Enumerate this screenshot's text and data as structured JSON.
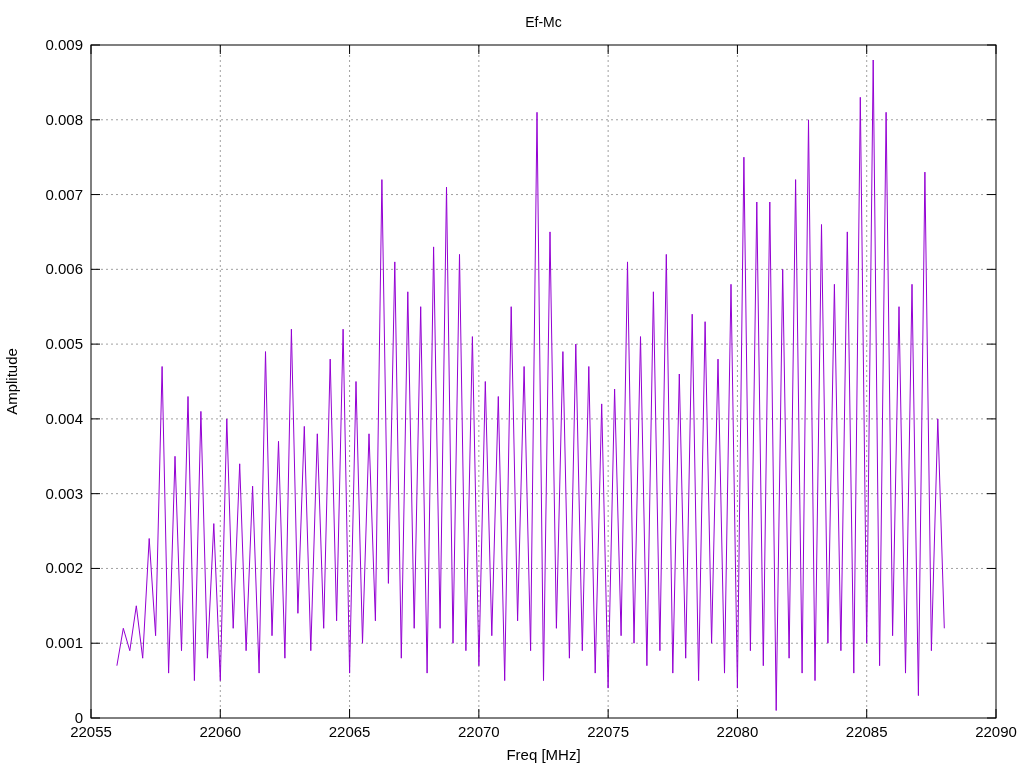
{
  "chart_data": {
    "type": "line",
    "title": "Ef-Mc",
    "xlabel": "Freq [MHz]",
    "ylabel": "Amplitude",
    "x": [
      22056,
      22056.25,
      22056.5,
      22056.75,
      22057,
      22057.25,
      22057.5,
      22057.75,
      22058,
      22058.25,
      22058.5,
      22058.75,
      22059,
      22059.25,
      22059.5,
      22059.75,
      22060,
      22060.25,
      22060.5,
      22060.75,
      22061,
      22061.25,
      22061.5,
      22061.75,
      22062,
      22062.25,
      22062.5,
      22062.75,
      22063,
      22063.25,
      22063.5,
      22063.75,
      22064,
      22064.25,
      22064.5,
      22064.75,
      22065,
      22065.25,
      22065.5,
      22065.75,
      22066,
      22066.25,
      22066.5,
      22066.75,
      22067,
      22067.25,
      22067.5,
      22067.75,
      22068,
      22068.25,
      22068.5,
      22068.75,
      22069,
      22069.25,
      22069.5,
      22069.75,
      22070,
      22070.25,
      22070.5,
      22070.75,
      22071,
      22071.25,
      22071.5,
      22071.75,
      22072,
      22072.25,
      22072.5,
      22072.75,
      22073,
      22073.25,
      22073.5,
      22073.75,
      22074,
      22074.25,
      22074.5,
      22074.75,
      22075,
      22075.25,
      22075.5,
      22075.75,
      22076,
      22076.25,
      22076.5,
      22076.75,
      22077,
      22077.25,
      22077.5,
      22077.75,
      22078,
      22078.25,
      22078.5,
      22078.75,
      22079,
      22079.25,
      22079.5,
      22079.75,
      22080,
      22080.25,
      22080.5,
      22080.75,
      22081,
      22081.25,
      22081.5,
      22081.75,
      22082,
      22082.25,
      22082.5,
      22082.75,
      22083,
      22083.25,
      22083.5,
      22083.75,
      22084,
      22084.25,
      22084.5,
      22084.75,
      22085,
      22085.25,
      22085.5,
      22085.75,
      22086,
      22086.25,
      22086.5,
      22086.75,
      22087,
      22087.25,
      22087.5,
      22087.75,
      22088
    ],
    "grid": true,
    "series": [
      {
        "color": "#9400d3",
        "values": [
          0.0007,
          0.0012,
          0.0009,
          0.0015,
          0.0008,
          0.0024,
          0.0011,
          0.0047,
          0.0006,
          0.0035,
          0.0009,
          0.0043,
          0.0005,
          0.0041,
          0.0008,
          0.0026,
          0.0005,
          0.004,
          0.0012,
          0.0034,
          0.0009,
          0.0031,
          0.0006,
          0.0049,
          0.0011,
          0.0037,
          0.0008,
          0.0052,
          0.0014,
          0.0039,
          0.0009,
          0.0038,
          0.0012,
          0.0048,
          0.0013,
          0.0052,
          0.0006,
          0.0045,
          0.001,
          0.0038,
          0.0013,
          0.0072,
          0.0018,
          0.0061,
          0.0008,
          0.0057,
          0.0012,
          0.0055,
          0.0006,
          0.0063,
          0.0012,
          0.0071,
          0.001,
          0.0062,
          0.0009,
          0.0051,
          0.0007,
          0.0045,
          0.0011,
          0.0043,
          0.0005,
          0.0055,
          0.0013,
          0.0047,
          0.0009,
          0.0081,
          0.0005,
          0.0065,
          0.0012,
          0.0049,
          0.0008,
          0.005,
          0.0009,
          0.0047,
          0.0006,
          0.0042,
          0.0004,
          0.0044,
          0.0011,
          0.0061,
          0.001,
          0.0051,
          0.0007,
          0.0057,
          0.0009,
          0.0062,
          0.0006,
          0.0046,
          0.0008,
          0.0054,
          0.0005,
          0.0053,
          0.001,
          0.0048,
          0.0006,
          0.0058,
          0.0004,
          0.0075,
          0.0009,
          0.0069,
          0.0007,
          0.0069,
          0.0001,
          0.006,
          0.0008,
          0.0072,
          0.0006,
          0.008,
          0.0005,
          0.0066,
          0.001,
          0.0058,
          0.0009,
          0.0065,
          0.0006,
          0.0083,
          0.001,
          0.0088,
          0.0007,
          0.0081,
          0.0011,
          0.0055,
          0.0006,
          0.0058,
          0.0003,
          0.0073,
          0.0009,
          0.004,
          0.0012
        ]
      }
    ],
    "xlim": [
      22055,
      22090
    ],
    "ylim": [
      0,
      0.009
    ],
    "xticks": [
      22055,
      22060,
      22065,
      22070,
      22075,
      22080,
      22085,
      22090
    ],
    "yticks": [
      0,
      0.001,
      0.002,
      0.003,
      0.004,
      0.005,
      0.006,
      0.007,
      0.008,
      0.009
    ]
  }
}
